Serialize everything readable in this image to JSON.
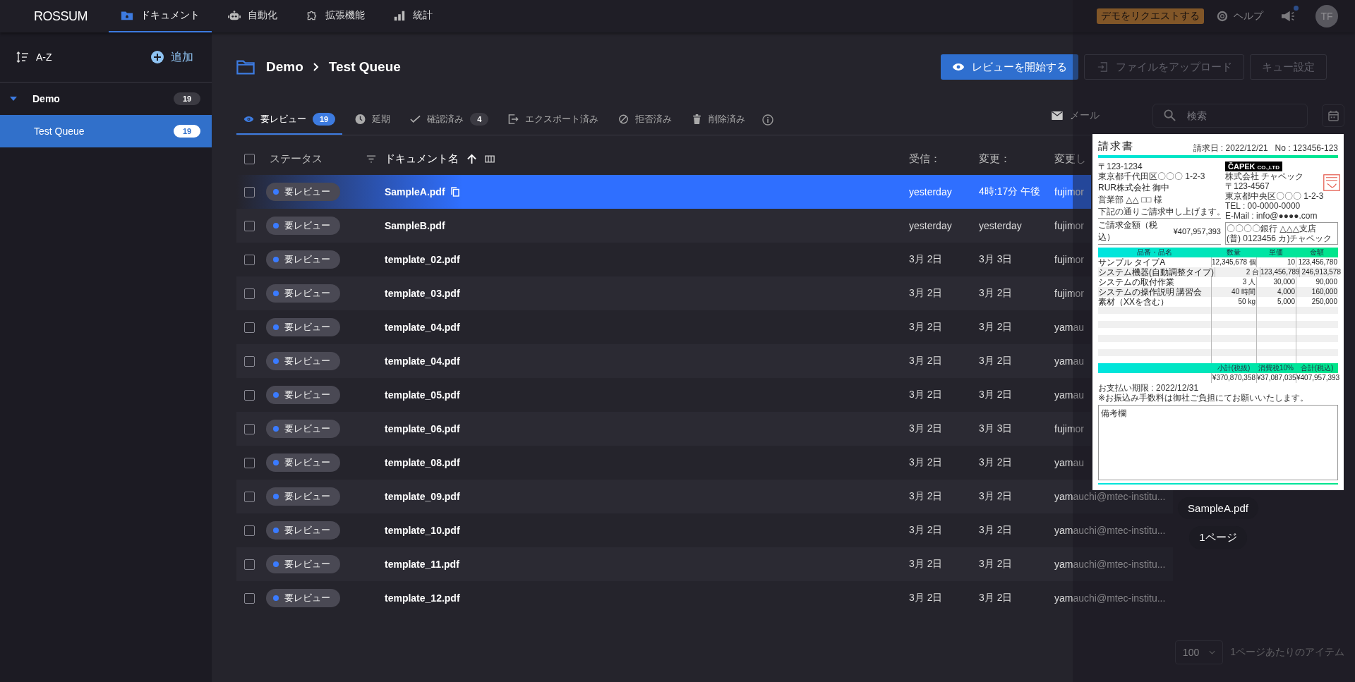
{
  "topbar": {
    "logo": "ROSSUM",
    "nav": [
      {
        "label": "ドキュメント",
        "selected": true
      },
      {
        "label": "自動化",
        "selected": false
      },
      {
        "label": "拡張機能",
        "selected": false
      },
      {
        "label": "統計",
        "selected": false
      }
    ],
    "demo_button": "デモをリクエストする",
    "help": "ヘルプ",
    "notification_unread": true,
    "avatar": "TF"
  },
  "sidebar": {
    "sort": "A-Z",
    "add": "追加",
    "tree": [
      {
        "label": "Demo",
        "count": "19",
        "expanded": true,
        "selected": false,
        "children": [
          {
            "label": "Test Queue",
            "count": "19",
            "selected": true
          }
        ]
      }
    ]
  },
  "header": {
    "breadcrumb": [
      "Demo",
      "Test Queue"
    ],
    "actions": [
      {
        "label": "レビューを開始する",
        "kind": "primary"
      },
      {
        "label": "ファイルをアップロード",
        "kind": "upload"
      },
      {
        "label": "キュー設定",
        "kind": "outline"
      }
    ]
  },
  "tabs": [
    {
      "label": "要レビュー",
      "count": "19",
      "selected": true
    },
    {
      "label": "延期",
      "selected": false
    },
    {
      "label": "確認済み",
      "count": "4",
      "selected": false
    },
    {
      "label": "エクスポート済み",
      "selected": false
    },
    {
      "label": "拒否済み",
      "selected": false
    },
    {
      "label": "削除済み",
      "selected": false
    }
  ],
  "mail": "メール",
  "search": {
    "placeholder": "検索"
  },
  "table": {
    "select_all_checked": false,
    "columns": [
      {
        "label": "ステータス",
        "kind": "filter"
      },
      {
        "label": "ドキュメント名",
        "kind": "sorted"
      },
      {
        "label": "受信：",
        "kind": "plain"
      },
      {
        "label": "変更：",
        "kind": "plain"
      },
      {
        "label": "変更し",
        "kind": "plain"
      }
    ],
    "rows": [
      {
        "status": "要レビュー",
        "name": "SampleA.pdf",
        "received": "yesterday",
        "modified": "4時:17分 午後",
        "column_5": "fujimor",
        "selected": true,
        "checked": false
      },
      {
        "status": "要レビュー",
        "name": "SampleB.pdf",
        "received": "yesterday",
        "modified": "yesterday",
        "column_5": "fujimor",
        "selected": false,
        "checked": false
      },
      {
        "status": "要レビュー",
        "name": "template_02.pdf",
        "received": "3月 2日",
        "modified": "3月 3日",
        "column_5": "fujimor",
        "selected": false,
        "checked": false
      },
      {
        "status": "要レビュー",
        "name": "template_03.pdf",
        "received": "3月 2日",
        "modified": "3月 2日",
        "column_5": "fujimor",
        "selected": false,
        "checked": false
      },
      {
        "status": "要レビュー",
        "name": "template_04.pdf",
        "received": "3月 2日",
        "modified": "3月 2日",
        "column_5": "yamau",
        "selected": false,
        "checked": false
      },
      {
        "status": "要レビュー",
        "name": "template_04.pdf",
        "received": "3月 2日",
        "modified": "3月 2日",
        "column_5": "yamau",
        "selected": false,
        "checked": false
      },
      {
        "status": "要レビュー",
        "name": "template_05.pdf",
        "received": "3月 2日",
        "modified": "3月 2日",
        "column_5": "yamau",
        "selected": false,
        "checked": false
      },
      {
        "status": "要レビュー",
        "name": "template_06.pdf",
        "received": "3月 2日",
        "modified": "3月 3日",
        "column_5": "fujimor",
        "selected": false,
        "checked": false
      },
      {
        "status": "要レビュー",
        "name": "template_08.pdf",
        "received": "3月 2日",
        "modified": "3月 2日",
        "column_5": "yamau",
        "selected": false,
        "checked": false
      },
      {
        "status": "要レビュー",
        "name": "template_09.pdf",
        "received": "3月 2日",
        "modified": "3月 2日",
        "column_5": "yamauchi@mtec-institu...",
        "selected": false,
        "checked": false
      },
      {
        "status": "要レビュー",
        "name": "template_10.pdf",
        "received": "3月 2日",
        "modified": "3月 2日",
        "column_5": "yamauchi@mtec-institu...",
        "selected": false,
        "checked": false
      },
      {
        "status": "要レビュー",
        "name": "template_11.pdf",
        "received": "3月 2日",
        "modified": "3月 2日",
        "column_5": "yamauchi@mtec-institu...",
        "selected": false,
        "checked": false
      },
      {
        "status": "要レビュー",
        "name": "template_12.pdf",
        "received": "3月 2日",
        "modified": "3月 2日",
        "column_5": "yamauchi@mtec-institu...",
        "selected": false,
        "checked": false
      }
    ]
  },
  "pagination": {
    "per_page": "100",
    "label": "1ページあたりのアイテム"
  },
  "preview": {
    "document": {
      "title": "請求書",
      "date": "請求日 : 2022/12/21",
      "number": "No : 123456-123",
      "recipient": [
        "〒123-1234",
        "東京都千代田区〇〇〇 1-2-3"
      ],
      "company": "RUR株式会社 御中",
      "person": "営業部 △△ □□ 様",
      "intro": "下記の通りご請求申し上げます。",
      "amount_label": "ご請求金額（税込）",
      "amount": "¥407,957,393",
      "logo": "ČAPEK",
      "logo_suffix": "CO.,LTD",
      "issuer": [
        "株式会社 チャペック",
        "〒123-4567",
        "東京都中央区〇〇〇 1-2-3",
        "TEL : 00-0000-0000",
        "E-Mail : info@●●●●.com"
      ],
      "bank": [
        "〇〇〇〇銀行 △△△支店",
        "(普) 0123456 カ)チャペック"
      ],
      "columns": [
        "品番・品名",
        "数量",
        "単価",
        "金額"
      ],
      "items": [
        {
          "name": "サンプル タイプA",
          "qty": "12,345,678 個",
          "price": "10",
          "total": "123,456,780"
        },
        {
          "name": "システム機器(自動調整タイプ)",
          "qty": "2 台",
          "price": "123,456,789",
          "total": "246,913,578"
        },
        {
          "name": "システムの取付作業",
          "qty": "3 人",
          "price": "30,000",
          "total": "90,000"
        },
        {
          "name": "システムの操作説明 講習会",
          "qty": "40 時間",
          "price": "4,000",
          "total": "160,000"
        },
        {
          "name": "素材（XXを含む）",
          "qty": "50 kg",
          "price": "5,000",
          "total": "250,000"
        }
      ],
      "total_labels": [
        "小計(税抜)",
        "消費税10%",
        "合計(税込)"
      ],
      "totals": [
        "¥370,870,358",
        "¥37,087,035",
        "¥407,957,393"
      ],
      "due": "お支払い期限 : 2022/12/31",
      "fee_note": "※お振込み手数料は御社ご負担にてお願いいたします。",
      "remarks_label": "備考欄"
    },
    "file_name": "SampleA.pdf",
    "pages": "1ページ"
  }
}
